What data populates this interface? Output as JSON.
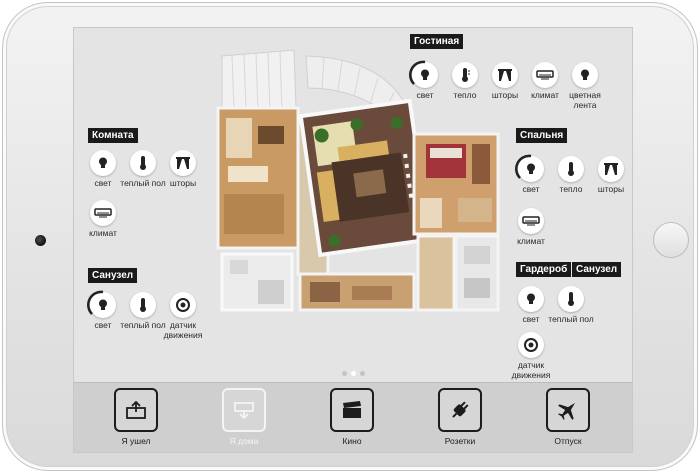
{
  "rooms": {
    "living": {
      "label": "Гостиная",
      "devices": [
        "свет",
        "тепло",
        "шторы",
        "климат",
        "цветная лента"
      ]
    },
    "room": {
      "label": "Комната",
      "devices": [
        "свет",
        "теплый пол",
        "шторы",
        "климат"
      ]
    },
    "bedroom": {
      "label": "Спальня",
      "devices": [
        "свет",
        "тепло",
        "шторы",
        "климат"
      ]
    },
    "bathroom_left": {
      "label": "Санузел",
      "devices": [
        "свет",
        "теплый пол",
        "датчик движения"
      ]
    },
    "wardrobe": {
      "label": "Гардероб"
    },
    "bathroom_right": {
      "label": "Санузел",
      "devices": [
        "свет",
        "теплый пол",
        "датчик движения"
      ]
    }
  },
  "scenes": [
    "Я ушел",
    "Я дома",
    "Кино",
    "Розетки",
    "Отпуск"
  ],
  "pager": {
    "count": 3,
    "active": 1
  },
  "colors": {
    "bezel": "#e6e6e6",
    "screen": "#e4e4e4",
    "bar": "#cfcfcf",
    "label_bg": "#1a1a1a",
    "scene_active": "#1c1c1c",
    "scene_dim": "#f4f4f4"
  },
  "icons": {
    "light": "bulb-icon",
    "heat": "thermometer-icon",
    "curtains": "curtains-icon",
    "climate": "air-conditioner-icon",
    "led": "led-strip-icon",
    "motion": "motion-sensor-icon",
    "away": "leave-home-icon",
    "home": "home-icon",
    "cinema": "clapperboard-icon",
    "sockets": "plug-icon",
    "vacation": "airplane-icon"
  }
}
